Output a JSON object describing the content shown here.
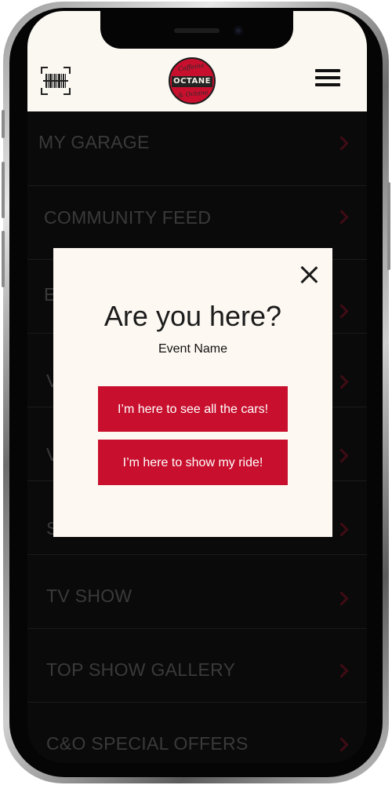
{
  "header": {
    "logo_text": "OCTANE",
    "logo_script_top": "Caffeine",
    "logo_script_bottom": "& Octane"
  },
  "menu": {
    "items": [
      {
        "label": "MY GARAGE"
      },
      {
        "label": "COMMUNITY FEED"
      },
      {
        "label": "E"
      },
      {
        "label": "V"
      },
      {
        "label": "V"
      },
      {
        "label": "S"
      },
      {
        "label": "TV SHOW"
      },
      {
        "label": "TOP SHOW GALLERY"
      },
      {
        "label": "C&O SPECIAL OFFERS"
      }
    ]
  },
  "modal": {
    "title": "Are you here?",
    "subtitle": "Event Name",
    "buttons": [
      {
        "label": "I’m here to see all the cars!"
      },
      {
        "label": "I’m here to show my ride!"
      }
    ]
  },
  "colors": {
    "accent": "#c8102e",
    "header_bg": "#fbf7f1",
    "modal_bg": "#fdf8f2",
    "menu_bg": "#0a0a0a"
  }
}
